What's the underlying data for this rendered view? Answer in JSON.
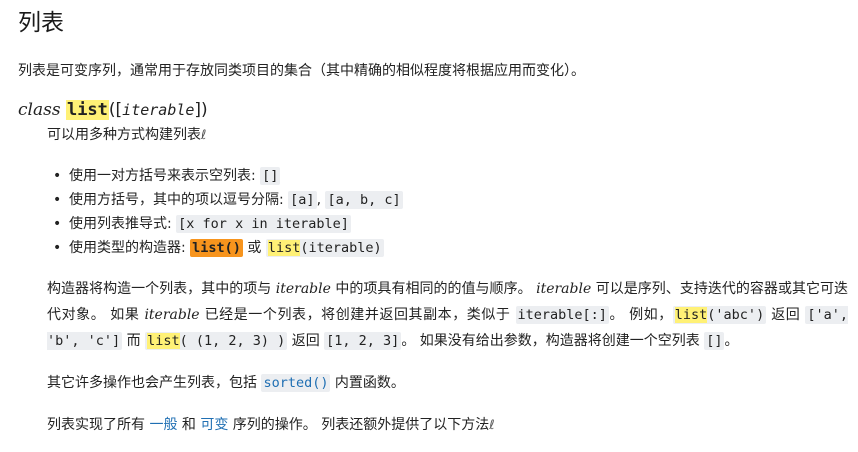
{
  "title": "列表",
  "intro": "列表是可变序列，通常用于存放同类项目的集合（其中精确的相似程度将根据应用而变化）。",
  "signature": {
    "keyword": "class",
    "name": "list",
    "open": "([",
    "param": "iterable",
    "close": "])"
  },
  "desc": "可以用多种方式构建列表",
  "pilcrow": "ℓ",
  "bullets": {
    "b1_text": "使用一对方括号来表示空列表: ",
    "b1_code": "[]",
    "b2_text": "使用方括号，其中的项以逗号分隔: ",
    "b2_code1": "[a]",
    "b2_sep": ", ",
    "b2_code2": "[a, b, c]",
    "b3_text": "使用列表推导式: ",
    "b3_code": "[x for x in iterable]",
    "b4_text": "使用类型的构造器: ",
    "b4_code1": "list()",
    "b4_mid": " 或 ",
    "b4_code2a": "list",
    "b4_code2b": "(iterable)"
  },
  "para1": {
    "t1": "构造器将构造一个列表，其中的项与 ",
    "em1": "iterable",
    "t2": " 中的项具有相同的的值与顺序。 ",
    "em2": "iterable",
    "t3": " 可以是序列、支持迭代的容器或其它可迭代对象。 如果 ",
    "em3": "iterable",
    "t4": " 已经是一个列表，将创建并返回其副本，类似于 ",
    "c1": "iterable[:]",
    "t5": "。 例如，",
    "c2a": "list",
    "c2b": "('abc')",
    "t6": " 返回 ",
    "c3": "['a', 'b', 'c']",
    "t7": " 而 ",
    "c4a": "list",
    "c4b": "( (1, 2, 3) )",
    "t8": " 返回 ",
    "c5": "[1, 2, 3]",
    "t9": "。 如果没有给出参数，构造器将创建一个空列表 ",
    "c6": "[]",
    "t10": "。"
  },
  "para2": {
    "t1": "其它许多操作也会产生列表，包括 ",
    "link": "sorted()",
    "t2": " 内置函数。"
  },
  "para3": {
    "t1": "列表实现了所有 ",
    "link1": "一般",
    "t2": " 和 ",
    "link2": "可变",
    "t3": " 序列的操作。 列表还额外提供了以下方法"
  },
  "colors": {
    "link": "#1f6fb3",
    "highlight": "#fff176",
    "highlight_strong": "#f7941d",
    "code_bg": "#eceef1"
  }
}
